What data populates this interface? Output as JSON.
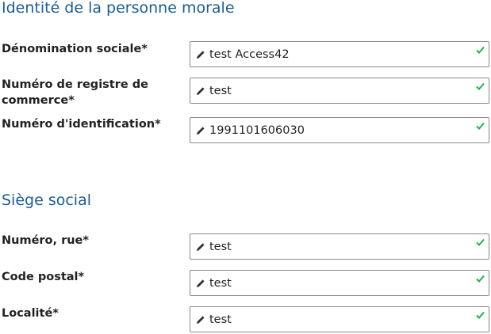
{
  "sections": [
    {
      "title": "Identité de la personne morale",
      "fields": [
        {
          "label": "Dénomination sociale*",
          "value": "test Access42"
        },
        {
          "label": "Numéro de registre de commerce*",
          "value": "test"
        },
        {
          "label": "Numéro d'identification*",
          "value": "1991101606030"
        }
      ]
    },
    {
      "title": "Siège social",
      "fields": [
        {
          "label": "Numéro, rue*",
          "value": "test"
        },
        {
          "label": "Code postal*",
          "value": "test"
        },
        {
          "label": "Localité*",
          "value": "test"
        }
      ]
    }
  ],
  "icons": {
    "edit": "pencil-icon",
    "valid": "checkmark-icon"
  },
  "colors": {
    "section_title": "#1a5e96",
    "valid_check": "#22b14c",
    "field_border": "#8a8a8a"
  }
}
